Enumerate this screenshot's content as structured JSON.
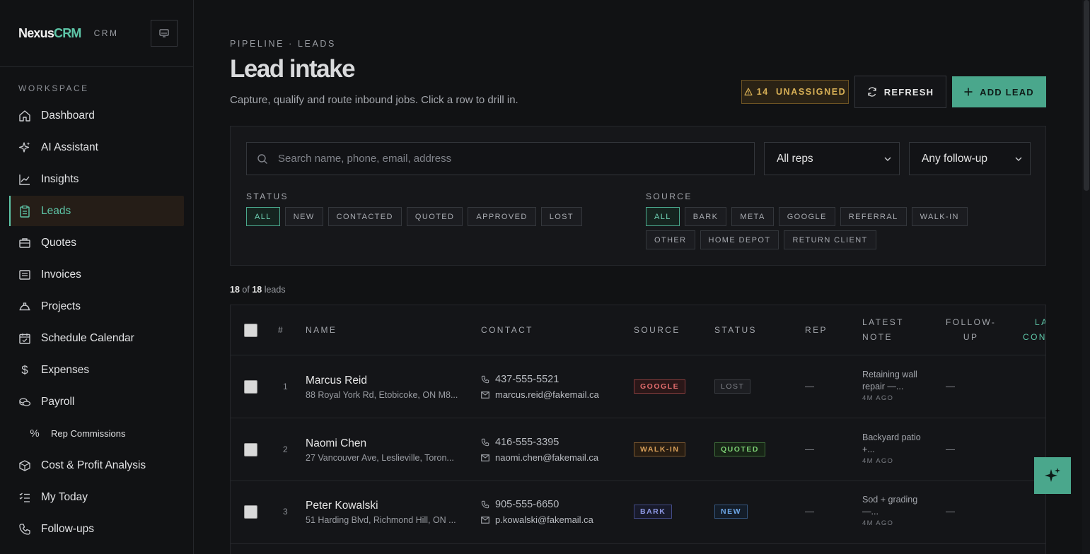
{
  "brand": {
    "name": "Nexus",
    "accent": "CRM",
    "sub": "CRM"
  },
  "sidebar": {
    "section": "WORKSPACE",
    "items": [
      {
        "label": "Dashboard",
        "icon": "home-icon"
      },
      {
        "label": "AI Assistant",
        "icon": "sparkle-icon"
      },
      {
        "label": "Insights",
        "icon": "chart-line-icon"
      },
      {
        "label": "Leads",
        "icon": "clipboard-icon",
        "active": true
      },
      {
        "label": "Quotes",
        "icon": "briefcase-icon"
      },
      {
        "label": "Invoices",
        "icon": "receipt-icon"
      },
      {
        "label": "Projects",
        "icon": "hard-hat-icon"
      },
      {
        "label": "Schedule Calendar",
        "icon": "calendar-check-icon"
      },
      {
        "label": "Expenses",
        "icon": "dollar-icon"
      },
      {
        "label": "Payroll",
        "icon": "coins-icon"
      },
      {
        "label": "Rep Commissions",
        "icon": "percent-icon",
        "sub": true
      },
      {
        "label": "Cost & Profit Analysis",
        "icon": "box-icon"
      },
      {
        "label": "My Today",
        "icon": "checklist-icon"
      },
      {
        "label": "Follow-ups",
        "icon": "phone-icon"
      }
    ]
  },
  "header": {
    "breadcrumb": "PIPELINE · LEADS",
    "title": "Lead intake",
    "subtitle": "Capture, qualify and route inbound jobs. Click a row to drill in.",
    "unassigned_label": "14  UNASSIGNED",
    "refresh_label": "REFRESH",
    "add_label": "ADD LEAD"
  },
  "filters": {
    "search_placeholder": "Search name, phone, email, address",
    "rep_select": "All reps",
    "followup_select": "Any follow-up",
    "status_label": "STATUS",
    "status_chips": [
      "ALL",
      "NEW",
      "CONTACTED",
      "QUOTED",
      "APPROVED",
      "LOST"
    ],
    "source_label": "SOURCE",
    "source_chips": [
      "ALL",
      "BARK",
      "META",
      "GOOGLE",
      "REFERRAL",
      "WALK-IN",
      "OTHER",
      "HOME DEPOT",
      "RETURN CLIENT"
    ]
  },
  "count": {
    "shown": "18",
    "of": "of",
    "total": "18",
    "unit": "leads"
  },
  "table": {
    "columns": {
      "num": "#",
      "name": "NAME",
      "contact": "CONTACT",
      "source": "SOURCE",
      "status": "STATUS",
      "rep": "REP",
      "note_1": "LATEST",
      "note_2": "NOTE",
      "fu_1": "FOLLOW-",
      "fu_2": "UP",
      "last_1": "LA",
      "last_2": "CON"
    },
    "rows": [
      {
        "num": "1",
        "name": "Marcus Reid",
        "address": "88 Royal York Rd, Etobicoke, ON M8...",
        "phone": "437-555-5521",
        "email": "marcus.reid@fakemail.ca",
        "source": "GOOGLE",
        "status": "LOST",
        "rep": "—",
        "note": "Retaining wall repair —...",
        "note_time": "4M AGO",
        "followup": "—"
      },
      {
        "num": "2",
        "name": "Naomi Chen",
        "address": "27 Vancouver Ave, Leslieville, Toron...",
        "phone": "416-555-3395",
        "email": "naomi.chen@fakemail.ca",
        "source": "WALK-IN",
        "status": "QUOTED",
        "rep": "—",
        "note": "Backyard patio +...",
        "note_time": "4M AGO",
        "followup": "—"
      },
      {
        "num": "3",
        "name": "Peter Kowalski",
        "address": "51 Harding Blvd, Richmond Hill, ON ...",
        "phone": "905-555-6650",
        "email": "p.kowalski@fakemail.ca",
        "source": "BARK",
        "status": "NEW",
        "rep": "—",
        "note": "Sod + grading —...",
        "note_time": "4M AGO",
        "followup": "—"
      }
    ]
  },
  "colors": {
    "accent": "#5ec6a8",
    "button": "#4aa78c",
    "warning": "#d8b056",
    "google": "#e06c6c",
    "walkin": "#d9a05a",
    "bark": "#8f9ae6",
    "quoted": "#7ccf74",
    "new": "#6ea8e8",
    "lost": "#80838a"
  }
}
